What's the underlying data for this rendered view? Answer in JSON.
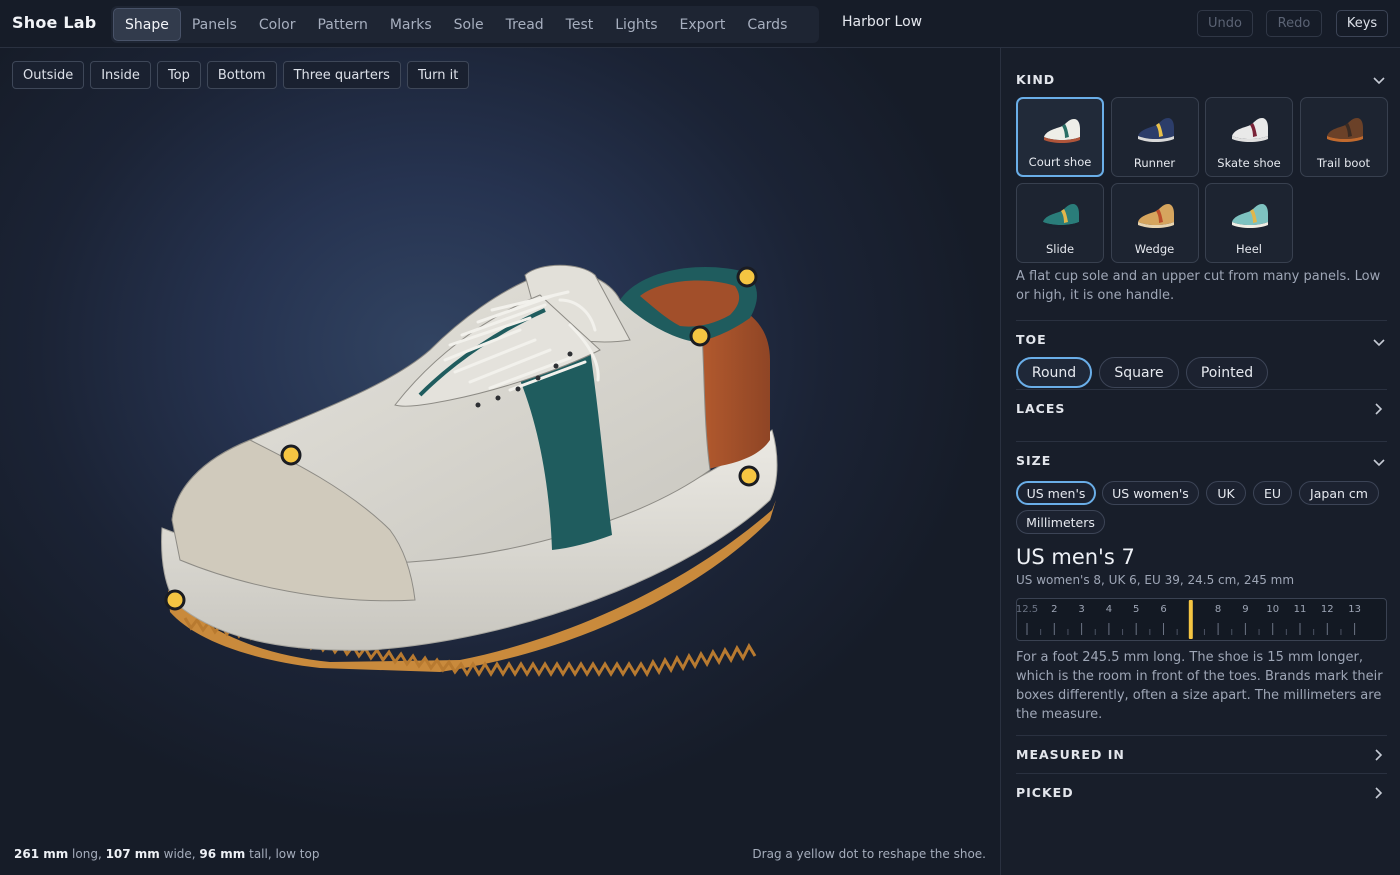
{
  "app": {
    "title": "Shoe Lab",
    "project_name": "Harbor Low"
  },
  "tabs": [
    "Shape",
    "Panels",
    "Color",
    "Pattern",
    "Marks",
    "Sole",
    "Tread",
    "Test",
    "Lights",
    "Export",
    "Cards"
  ],
  "active_tab": "Shape",
  "history": {
    "undo": "Undo",
    "redo": "Redo",
    "keys": "Keys",
    "undo_enabled": false,
    "redo_enabled": false
  },
  "views": [
    "Outside",
    "Inside",
    "Top",
    "Bottom",
    "Three quarters",
    "Turn it"
  ],
  "footer": {
    "length": "261 mm",
    "length_word": " long, ",
    "width": "107 mm",
    "width_word": " wide, ",
    "height": "96 mm",
    "height_word": " tall, low top",
    "hint": "Drag a yellow dot to reshape the shoe."
  },
  "kind": {
    "heading": "KIND",
    "items": [
      {
        "label": "Court shoe",
        "icon": "court-shoe-icon",
        "selected": true
      },
      {
        "label": "Runner",
        "icon": "runner-icon",
        "selected": false
      },
      {
        "label": "Skate shoe",
        "icon": "skate-shoe-icon",
        "selected": false
      },
      {
        "label": "Trail boot",
        "icon": "trail-boot-icon",
        "selected": false
      },
      {
        "label": "Slide",
        "icon": "slide-icon",
        "selected": false
      },
      {
        "label": "Wedge",
        "icon": "wedge-icon",
        "selected": false
      },
      {
        "label": "Heel",
        "icon": "heel-icon",
        "selected": false
      }
    ],
    "description": "A flat cup sole and an upper cut from many panels. Low or high, it is one handle."
  },
  "toe": {
    "heading": "TOE",
    "options": [
      "Round",
      "Square",
      "Pointed"
    ],
    "selected": "Round"
  },
  "laces": {
    "heading": "LACES"
  },
  "size": {
    "heading": "SIZE",
    "systems": [
      "US men's",
      "US women's",
      "UK",
      "EU",
      "Japan cm",
      "Millimeters"
    ],
    "selected_system": "US men's",
    "current": "US men's 7",
    "equivalents": "US women's 8, UK 6, EU 39, 24.5 cm, 245 mm",
    "ruler_labels": [
      "12.5",
      "2",
      "3",
      "4",
      "5",
      "6",
      "",
      "8",
      "9",
      "10",
      "11",
      "12",
      "13"
    ],
    "ruler_value": 7,
    "note": "For a foot 245.5 mm long. The shoe is 15 mm longer, which is the room in front of the toes. Brands mark their boxes differently, often a size apart. The millimeters are the measure."
  },
  "measured_in": {
    "heading": "MEASURED IN"
  },
  "picked": {
    "heading": "PICKED"
  },
  "colors": {
    "accent": "#6aaee8",
    "handle": "#f5c542",
    "teal": "#1f5c5e",
    "rust": "#a8522c",
    "upper": "#d8d6cf",
    "gum": "#c98a3c"
  }
}
